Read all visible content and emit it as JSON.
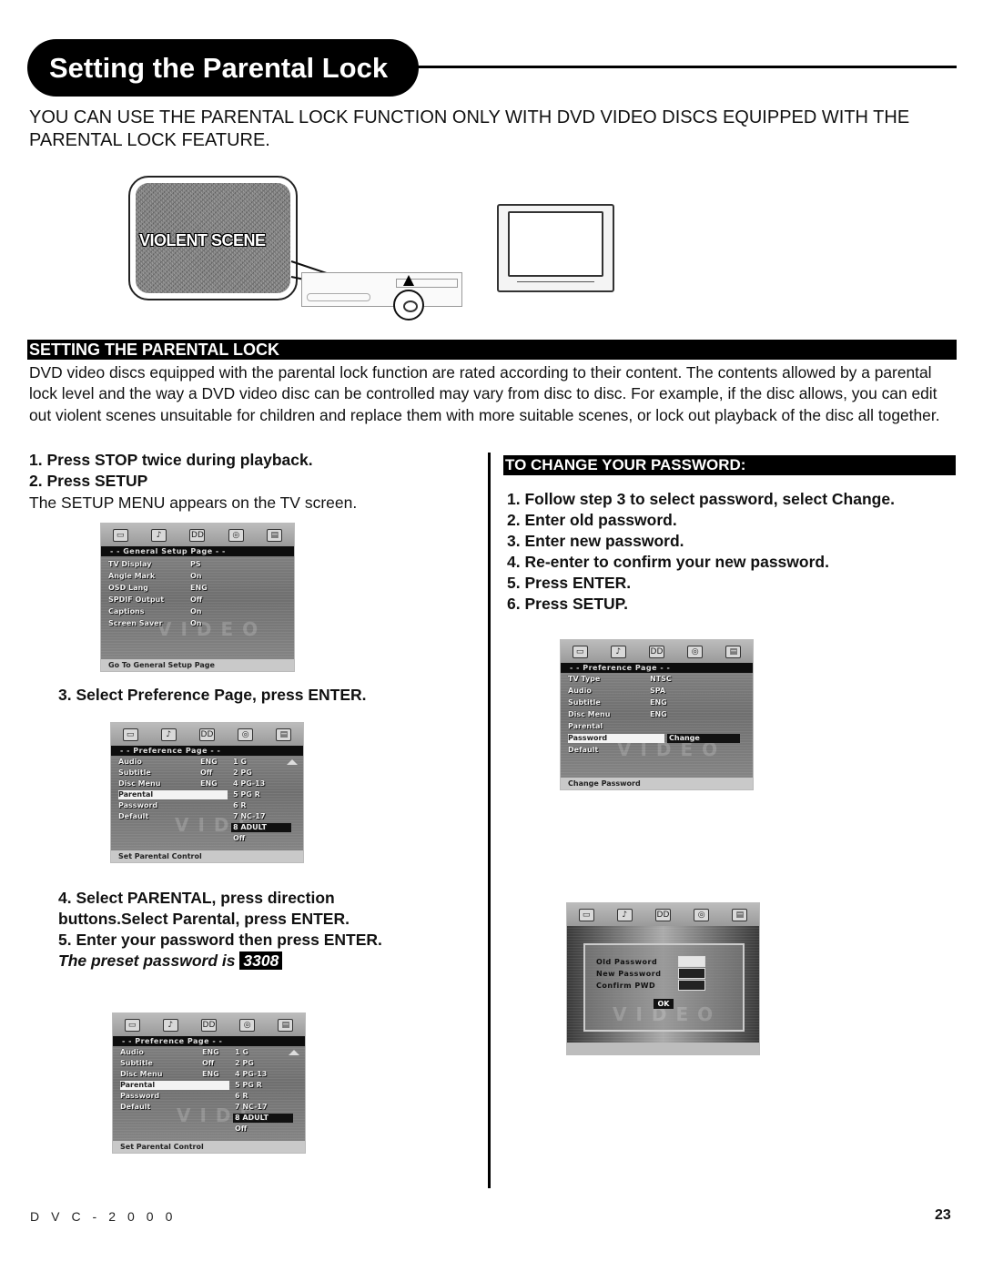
{
  "page": {
    "title": "Setting the Parental Lock",
    "intro": "YOU CAN USE THE PARENTAL LOCK FUNCTION ONLY WITH DVD VIDEO DISCS EQUIPPED WITH THE PARENTAL LOCK FEATURE.",
    "illustration": {
      "callout_label": "VIOLENT SCENE"
    },
    "section_heading": "SETTING THE PARENTAL LOCK",
    "description": "DVD video discs equipped with the parental lock function are rated according to their content.  The contents allowed by a parental lock level and the way a DVD video disc can be controlled may vary from disc to disc.  For example, if the disc allows, you can edit out violent scenes unsuitable for children and replace them with more suitable scenes, or lock out playback of the disc all together.",
    "left_steps": {
      "step1": "1. Press STOP twice during playback.",
      "step2": "2. Press SETUP",
      "step2_note": "The SETUP MENU appears on the TV screen.",
      "step3": "3. Select Preference Page,  press ENTER.",
      "step4": "4. Select PARENTAL, press direction buttons.Select Parental, press ENTER.",
      "step5": "5. Enter your password then press ENTER.",
      "preset_text": "The preset password is",
      "preset_password": "3308"
    },
    "change_password": {
      "heading": "TO CHANGE YOUR PASSWORD:",
      "steps": [
        "1. Follow step 3 to select password, select Change.",
        "2. Enter old password.",
        "3. Enter new password.",
        "4. Re-enter to confirm your new password.",
        "5. Press ENTER.",
        "6. Press SETUP."
      ]
    },
    "footer": {
      "model": "DVC-2000",
      "page_number": "23"
    }
  },
  "osd": {
    "general": {
      "header": "- -  General  Setup  Page  - -",
      "rows": [
        {
          "label": "TV Display",
          "value": "PS"
        },
        {
          "label": "Angle Mark",
          "value": "On"
        },
        {
          "label": "OSD Lang",
          "value": "ENG"
        },
        {
          "label": "SPDIF Output",
          "value": "Off"
        },
        {
          "label": "Captions",
          "value": "On"
        },
        {
          "label": "Screen Saver",
          "value": "On"
        }
      ],
      "footer": "Go To General Setup Page",
      "watermark": "VIDEO"
    },
    "preference_parental": {
      "header": "- -  Preference  Page  - -",
      "rows": [
        {
          "label": "Audio",
          "value": "ENG"
        },
        {
          "label": "Subtitle",
          "value": "Off"
        },
        {
          "label": "Disc Menu",
          "value": "ENG"
        },
        {
          "label": "Parental",
          "value": ""
        },
        {
          "label": "Password",
          "value": ""
        },
        {
          "label": "Default",
          "value": ""
        }
      ],
      "selected_row": "Parental",
      "options": [
        "1 G",
        "2 PG",
        "4 PG-13",
        "5 PG R",
        "6 R",
        "7 NC-17",
        "8 ADULT",
        "Off"
      ],
      "selected_option": "8 ADULT",
      "footer": "Set Parental Control",
      "watermark": "VIDE"
    },
    "preference_password": {
      "header": "- -  Preference  Page  - -",
      "rows": [
        {
          "label": "TV Type",
          "value": "NTSC"
        },
        {
          "label": "Audio",
          "value": "SPA"
        },
        {
          "label": "Subtitle",
          "value": "ENG"
        },
        {
          "label": "Disc Menu",
          "value": "ENG"
        },
        {
          "label": "Parental",
          "value": ""
        },
        {
          "label": "Password",
          "value": ""
        },
        {
          "label": "Default",
          "value": ""
        }
      ],
      "selected_row": "Password",
      "option": "Change",
      "footer": "Change Password",
      "watermark": "VIDEO"
    },
    "password_dialog": {
      "fields": [
        "Old Password",
        "New Password",
        "Confirm PWD"
      ],
      "ok_label": "OK",
      "watermark": "VIDEO"
    },
    "icons": [
      "general-setup-icon",
      "audio-setup-icon",
      "dolby-digital-icon",
      "video-setup-icon",
      "preference-icon"
    ]
  }
}
